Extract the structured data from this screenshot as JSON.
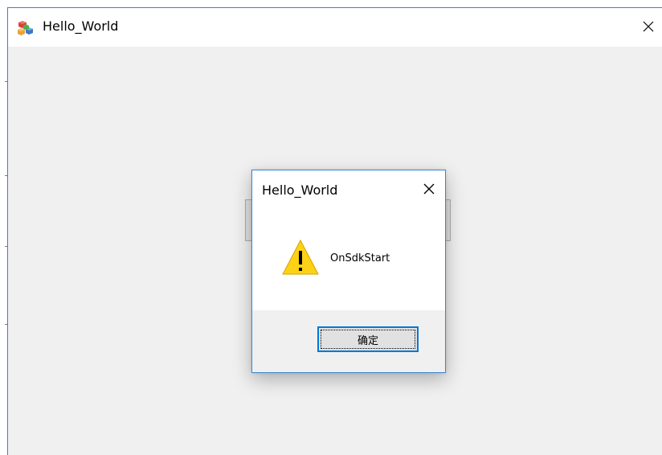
{
  "main_window": {
    "title": "Hello_World",
    "icon": "app-cubes-icon",
    "close_icon": "close-icon"
  },
  "dialog": {
    "title": "Hello_World",
    "icon": "warning-icon",
    "message": "OnSdkStart",
    "ok_label": "确定",
    "close_icon": "close-icon"
  },
  "colors": {
    "window_border": "#3a7fd0",
    "client_bg": "#f0f0f0",
    "focus_border": "#0078d7",
    "warning_fill": "#fcd116"
  }
}
